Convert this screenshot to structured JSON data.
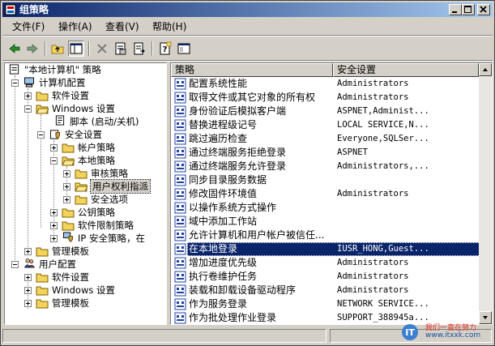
{
  "window": {
    "title": "组策略"
  },
  "menu": [
    "文件(F)",
    "操作(A)",
    "查看(V)",
    "帮助(H)"
  ],
  "toolbar": {
    "icons": [
      "back-arrow-icon",
      "forward-arrow-icon",
      "up-folder-icon",
      "show-hide-tree-icon",
      "delete-icon",
      "properties-icon",
      "export-list-icon",
      "help-icon",
      "show-console-icon"
    ]
  },
  "tree": {
    "root": "\"本地计算机\" 策略",
    "computer_config": "计算机配置",
    "software_settings": "软件设置",
    "windows_settings": "Windows 设置",
    "scripts": "脚本 (启动/关机)",
    "security_settings": "安全设置",
    "account_policies": "帐户策略",
    "local_policies": "本地策略",
    "audit_policy": "审核策略",
    "user_rights": "用户权利指派",
    "security_options": "安全选项",
    "public_key": "公钥策略",
    "software_restriction": "软件限制策略",
    "ip_security": "IP 安全策略，在",
    "admin_templates": "管理模板",
    "user_config": "用户配置",
    "user_software_settings": "软件设置",
    "user_windows_settings": "Windows 设置",
    "user_admin_templates": "管理模板"
  },
  "list": {
    "col_policy": "策略",
    "col_setting": "安全设置",
    "rows": [
      {
        "name": "配置系统性能",
        "value": "Administrators"
      },
      {
        "name": "取得文件或其它对象的所有权",
        "value": "Administrators"
      },
      {
        "name": "身份验证后模拟客户端",
        "value": "ASPNET,Administ..."
      },
      {
        "name": "替换进程级记号",
        "value": "LOCAL SERVICE,N..."
      },
      {
        "name": "跳过遍历检查",
        "value": "Everyone,SQLSer..."
      },
      {
        "name": "通过终端服务拒绝登录",
        "value": "ASPNET"
      },
      {
        "name": "通过终端服务允许登录",
        "value": "Administrators,..."
      },
      {
        "name": "同步目录服务数据",
        "value": ""
      },
      {
        "name": "修改固件环境值",
        "value": "Administrators"
      },
      {
        "name": "以操作系统方式操作",
        "value": ""
      },
      {
        "name": "域中添加工作站",
        "value": ""
      },
      {
        "name": "允许计算机和用户帐户被信任...",
        "value": ""
      },
      {
        "name": "在本地登录",
        "value": "IUSR_HONG,Guest..."
      },
      {
        "name": "增加进度优先级",
        "value": "Administrators"
      },
      {
        "name": "执行卷维护任务",
        "value": "Administrators"
      },
      {
        "name": "装载和卸载设备驱动程序",
        "value": "Administrators"
      },
      {
        "name": "作为服务登录",
        "value": "NETWORK SERVICE..."
      },
      {
        "name": "作为批处理作业登录",
        "value": "SUPPORT_388945a..."
      }
    ],
    "selected_index": 12
  },
  "watermark": {
    "line1": "我们一直在努力",
    "line2": "www.itxxk.com"
  },
  "colors": {
    "title_start": "#0a246a",
    "title_end": "#a6caf0",
    "selection": "#0a246a",
    "chrome": "#d4d0c8"
  }
}
